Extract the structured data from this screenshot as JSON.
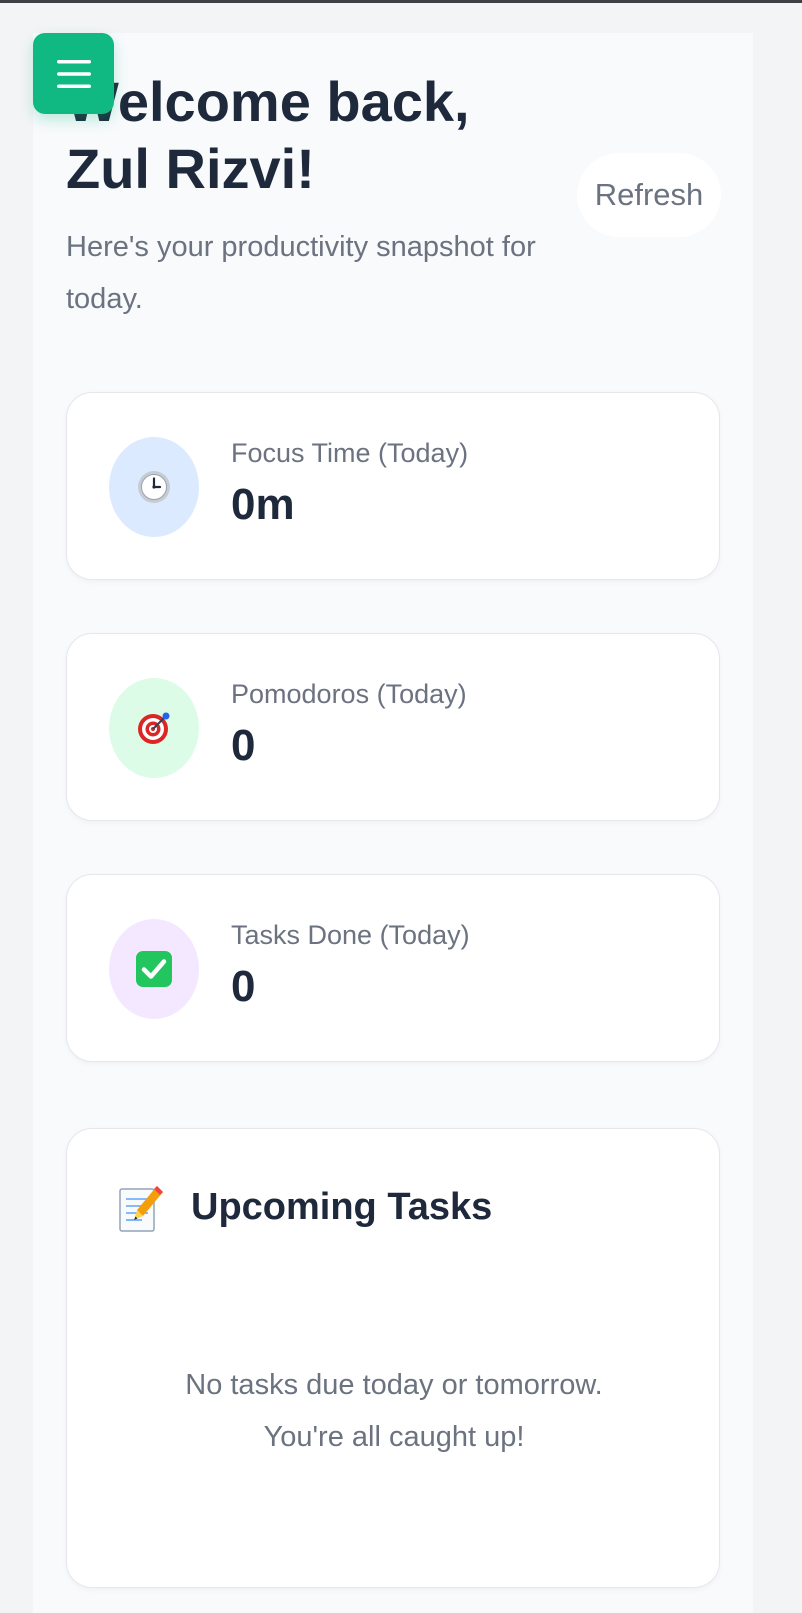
{
  "header": {
    "title_line1": "Welcome back,",
    "title_line2": "Zul Rizvi!",
    "subtitle": "Here's your productivity snapshot for today.",
    "refresh_label": "Refresh",
    "menu_icon": "hamburger-menu-icon"
  },
  "stats": [
    {
      "label": "Focus Time (Today)",
      "value": "0m",
      "icon": "clock-icon",
      "icon_bg": "#dbeafe"
    },
    {
      "label": "Pomodoros (Today)",
      "value": "0",
      "icon": "target-icon",
      "icon_bg": "#dcfce7"
    },
    {
      "label": "Tasks Done (Today)",
      "value": "0",
      "icon": "checkmark-icon",
      "icon_bg": "#f3e8ff"
    }
  ],
  "upcoming": {
    "title": "Upcoming Tasks",
    "icon": "memo-icon",
    "empty_line1": "No tasks due today or tomorrow.",
    "empty_line2": "You're all caught up!"
  },
  "colors": {
    "accent": "#10b981",
    "text_dark": "#1e293b",
    "text_muted": "#6b7280",
    "background": "#f3f4f6"
  }
}
